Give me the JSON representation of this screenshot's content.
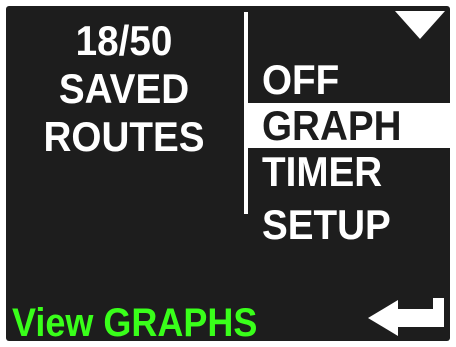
{
  "status": {
    "count": "18/50",
    "label_line1": "SAVED",
    "label_line2": "ROUTES"
  },
  "menu": {
    "items": [
      {
        "label": "OFF",
        "selected": false
      },
      {
        "label": "GRAPH",
        "selected": true
      },
      {
        "label": "TIMER",
        "selected": false
      },
      {
        "label": "SETUP",
        "selected": false
      }
    ]
  },
  "footer": {
    "hint": "View GRAPHS",
    "enter_icon": "enter-return-icon"
  },
  "icons": {
    "scroll": "triangle-down-icon"
  },
  "colors": {
    "background": "#1d1d1d",
    "text": "#ffffff",
    "selection_background": "#ffffff",
    "selection_text": "#1d1d1d",
    "hint": "#39ff1a"
  }
}
